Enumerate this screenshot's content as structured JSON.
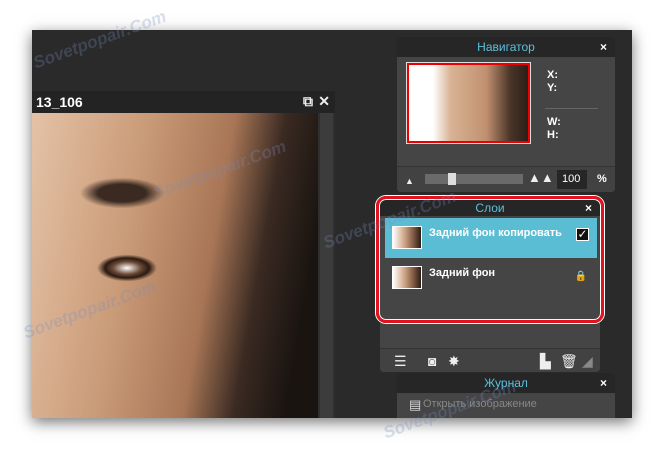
{
  "document": {
    "title": "13_106",
    "restore_icon": "⧉",
    "close_icon": "✕"
  },
  "navigator": {
    "title": "Навигатор",
    "close": "×",
    "x_label": "X:",
    "y_label": "Y:",
    "w_label": "W:",
    "h_label": "H:",
    "zoom_value": "100",
    "zoom_unit": "%"
  },
  "layers": {
    "title": "Слои",
    "close": "×",
    "items": [
      {
        "name": "Задний фон копировать",
        "selected": true,
        "visible": true
      },
      {
        "name": "Задний фон",
        "locked": true
      }
    ]
  },
  "journal": {
    "title": "Журнал",
    "close": "×",
    "items": [
      {
        "label": "Открыть изображение"
      }
    ]
  },
  "watermark": "Sovetpopair.Com",
  "colors": {
    "accent": "#5bbdd3",
    "highlight": "#e0141e"
  }
}
